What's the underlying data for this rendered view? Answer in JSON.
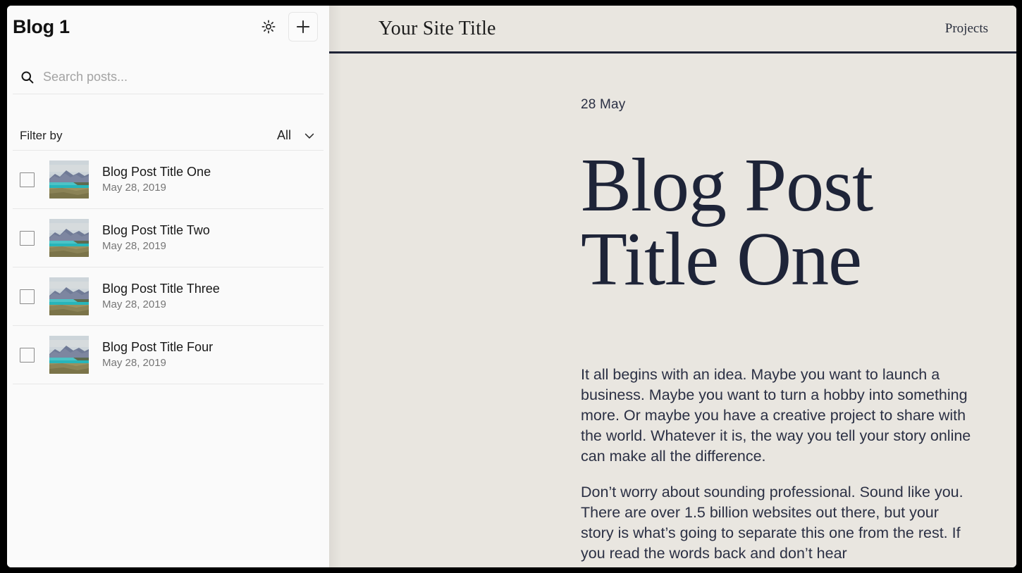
{
  "sidebar": {
    "title": "Blog 1",
    "settings_icon": "gear-icon",
    "add_icon": "plus-icon",
    "search": {
      "icon": "search-icon",
      "placeholder": "Search posts...",
      "value": ""
    },
    "filter": {
      "label": "Filter by",
      "value": "All",
      "chevron_icon": "chevron-down-icon"
    },
    "posts": [
      {
        "title": "Blog Post Title One",
        "date": "May 28, 2019",
        "checked": false
      },
      {
        "title": "Blog Post Title Two",
        "date": "May 28, 2019",
        "checked": false
      },
      {
        "title": "Blog Post Title Three",
        "date": "May 28, 2019",
        "checked": false
      },
      {
        "title": "Blog Post Title Four",
        "date": "May 28, 2019",
        "checked": false
      }
    ]
  },
  "preview": {
    "site_title": "Your Site Title",
    "nav": "Projects",
    "article": {
      "date": "28 May",
      "title": "Blog Post Title One",
      "paragraphs": [
        "It all begins with an idea. Maybe you want to launch a business. Maybe you want to turn a hobby into something more. Or maybe you have a creative project to share with the world. Whatever it is, the way you tell your story online can make all the difference.",
        "Don’t worry about sounding professional. Sound like you. There are over 1.5 billion websites out there, but your story is what’s going to separate this one from the rest. If you read the words back and don’t hear"
      ]
    }
  },
  "colors": {
    "sidebar_bg": "#fafafa",
    "preview_bg": "#e9e6e0",
    "ink": "#1e2438",
    "muted": "#767676",
    "frame": "#000000"
  }
}
